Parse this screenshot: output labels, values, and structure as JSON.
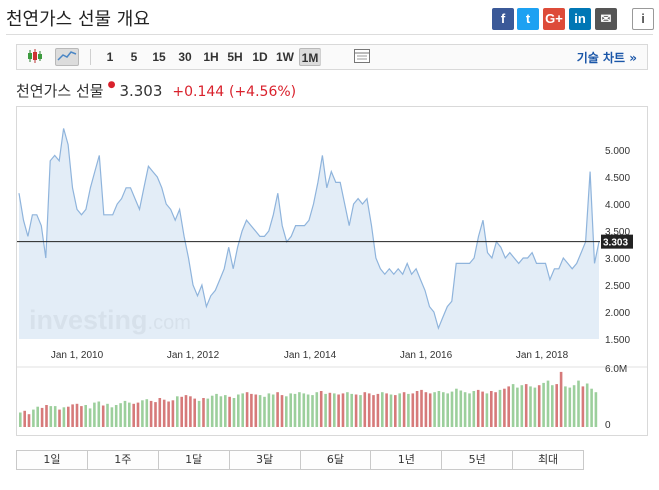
{
  "page": {
    "title": "천연가스 선물 개요"
  },
  "share": [
    {
      "name": "facebook-icon",
      "glyph": "f",
      "color": "#3b5998"
    },
    {
      "name": "twitter-icon",
      "glyph": "t",
      "color": "#1da1f2"
    },
    {
      "name": "google-plus-icon",
      "glyph": "G+",
      "color": "#dd4b39"
    },
    {
      "name": "linkedin-icon",
      "glyph": "in",
      "color": "#0077b5"
    },
    {
      "name": "email-icon",
      "glyph": "✉",
      "color": "#555555"
    },
    {
      "name": "info-icon",
      "glyph": "i",
      "color": "#555555"
    }
  ],
  "toolbar": {
    "intervals": [
      "1",
      "5",
      "15",
      "30",
      "1H",
      "5H",
      "1D",
      "1W",
      "1M"
    ],
    "active_interval": "1M",
    "tech_chart_link": "기술 차트 »"
  },
  "quote": {
    "name": "천연가스 선물",
    "price": "3.303",
    "change": "+0.144",
    "change_pct": "(+4.56%)"
  },
  "chart_data": {
    "type": "area",
    "x_ticks": [
      "Jan 1, 2010",
      "Jan 1, 2012",
      "Jan 1, 2014",
      "Jan 1, 2016",
      "Jan 1, 2018"
    ],
    "y_ticks": [
      "5.000",
      "4.500",
      "4.000",
      "3.500",
      "3.000",
      "2.500",
      "2.000",
      "1.500"
    ],
    "ylim": [
      1.5,
      5.5
    ],
    "current_value_label": "3.303",
    "watermark": "investing.com",
    "price_series": [
      4.2,
      3.7,
      3.4,
      3.8,
      3.8,
      3.6,
      3.0,
      4.8,
      4.9,
      4.8,
      5.4,
      5.1,
      4.3,
      3.9,
      3.8,
      3.9,
      4.3,
      4.6,
      4.9,
      3.8,
      3.8,
      3.8,
      4.0,
      4.1,
      4.3,
      4.3,
      4.1,
      3.9,
      4.3,
      4.7,
      4.6,
      4.5,
      4.3,
      4.0,
      3.9,
      3.7,
      3.9,
      3.4,
      3.0,
      2.5,
      2.3,
      2.5,
      2.1,
      2.3,
      2.4,
      2.6,
      2.8,
      3.2,
      2.8,
      3.2,
      3.5,
      3.7,
      3.6,
      3.5,
      3.4,
      3.4,
      3.5,
      3.8,
      4.2,
      3.6,
      3.3,
      3.4,
      3.6,
      3.6,
      3.6,
      3.7,
      4.0,
      4.4,
      4.9,
      4.3,
      4.6,
      4.4,
      4.4,
      4.0,
      3.6,
      4.0,
      4.1,
      4.0,
      4.1,
      3.6,
      3.0,
      2.8,
      2.7,
      2.8,
      2.7,
      2.8,
      2.7,
      2.9,
      2.7,
      2.8,
      2.6,
      2.4,
      2.1,
      2.0,
      1.7,
      1.9,
      2.1,
      2.2,
      2.9,
      2.9,
      2.9,
      2.9,
      3.0,
      3.4,
      3.7,
      3.1,
      3.0,
      3.3,
      3.2,
      3.0,
      3.1,
      3.0,
      2.9,
      3.0,
      3.0,
      3.1,
      2.9,
      2.9,
      2.9,
      2.6,
      2.8,
      2.8,
      3.0,
      2.9,
      2.8,
      2.9,
      3.1,
      3.3,
      4.6,
      2.9,
      3.3
    ],
    "volume_series": [
      0.25,
      0.28,
      0.22,
      0.3,
      0.35,
      0.33,
      0.38,
      0.36,
      0.36,
      0.3,
      0.34,
      0.35,
      0.39,
      0.4,
      0.36,
      0.38,
      0.32,
      0.42,
      0.44,
      0.37,
      0.4,
      0.34,
      0.38,
      0.41,
      0.45,
      0.42,
      0.4,
      0.42,
      0.46,
      0.48,
      0.45,
      0.43,
      0.5,
      0.47,
      0.44,
      0.46,
      0.53,
      0.52,
      0.55,
      0.53,
      0.49,
      0.45,
      0.5,
      0.49,
      0.54,
      0.57,
      0.53,
      0.55,
      0.52,
      0.5,
      0.56,
      0.58,
      0.6,
      0.57,
      0.56,
      0.55,
      0.52,
      0.58,
      0.56,
      0.6,
      0.55,
      0.53,
      0.58,
      0.57,
      0.6,
      0.58,
      0.56,
      0.55,
      0.6,
      0.62,
      0.57,
      0.59,
      0.58,
      0.56,
      0.58,
      0.6,
      0.57,
      0.56,
      0.55,
      0.6,
      0.58,
      0.55,
      0.57,
      0.6,
      0.58,
      0.56,
      0.55,
      0.58,
      0.6,
      0.57,
      0.58,
      0.62,
      0.64,
      0.6,
      0.58,
      0.6,
      0.62,
      0.6,
      0.58,
      0.61,
      0.66,
      0.63,
      0.6,
      0.58,
      0.62,
      0.64,
      0.61,
      0.58,
      0.62,
      0.6,
      0.64,
      0.66,
      0.7,
      0.74,
      0.68,
      0.72,
      0.74,
      0.7,
      0.68,
      0.72,
      0.76,
      0.8,
      0.72,
      0.74,
      0.95,
      0.7,
      0.68,
      0.72,
      0.8,
      0.7,
      0.75,
      0.66,
      0.6
    ],
    "volume_ticks": [
      "6.0M",
      "0"
    ]
  },
  "periods": [
    "1일",
    "1주",
    "1달",
    "3달",
    "6달",
    "1년",
    "5년",
    "최대"
  ]
}
